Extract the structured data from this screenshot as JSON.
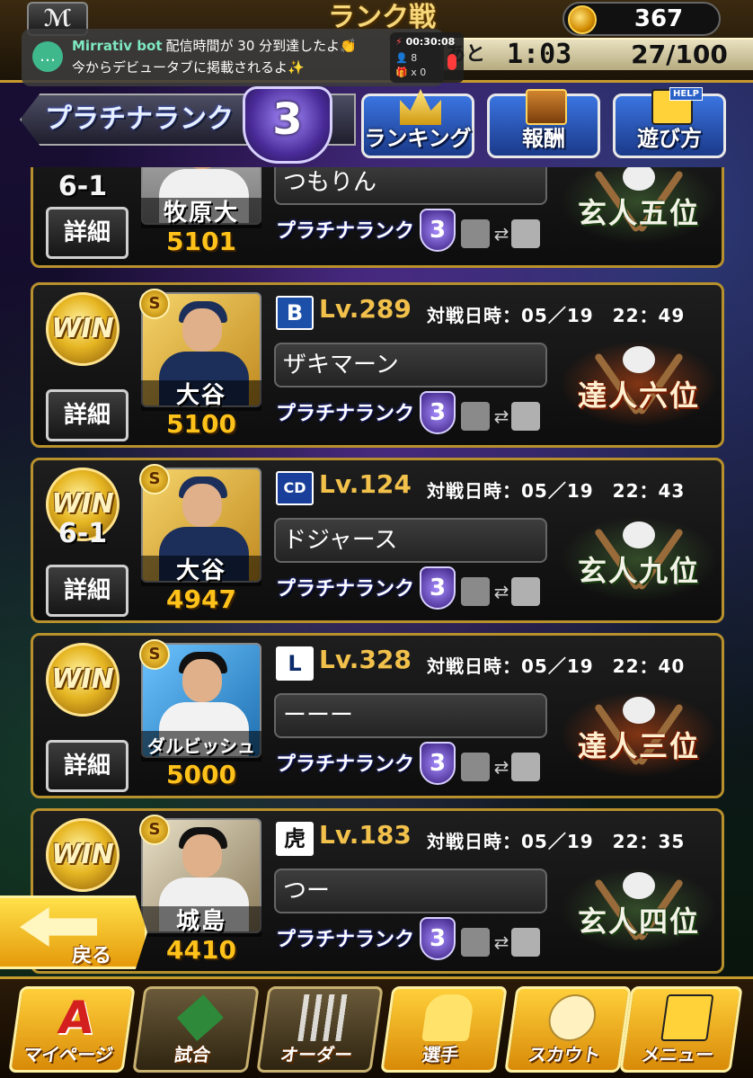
{
  "header": {
    "logo_text": "ℳ",
    "title": "ランク戦",
    "coins": "367",
    "time_label": "あと",
    "time_left": "1:03",
    "battle_count": "27/100"
  },
  "overlay": {
    "bot_name": "Mirrativ bot",
    "line1": "配信時間が 30 分到達したよ👏",
    "line2": "今からデビュータブに掲載されるよ✨",
    "elapsed": "00:30:08",
    "viewers": "8",
    "gifts": "x 0"
  },
  "rank": {
    "label": "プラチナランク",
    "level": "3"
  },
  "header_buttons": [
    {
      "label": "ランキング",
      "icon": "crown-icon"
    },
    {
      "label": "報酬",
      "icon": "treasure-chest-icon"
    },
    {
      "label": "遊び方",
      "icon": "help-icon",
      "tag": "HELP"
    }
  ],
  "matches": [
    {
      "result": "",
      "score": "6-1",
      "detail_label": "詳細",
      "player_name": "牧原大",
      "player_score": "5101",
      "grade": "",
      "team_logo": "",
      "level": "",
      "date": "",
      "opponent": "つもりん",
      "opp_rank": "プラチナランク",
      "opp_rank_num": "3",
      "title": "玄人五位",
      "title_style": "green",
      "photo_colors": [
        "#c9c9c9",
        "#f0f0f0",
        "#222"
      ]
    },
    {
      "result": "WIN",
      "score": "",
      "detail_label": "詳細",
      "player_name": "大谷",
      "player_score": "5100",
      "grade": "S",
      "team_logo": "B",
      "level": "Lv.289",
      "date": "対戦日時：05／19　22：49",
      "opponent": "ザキマーン",
      "opp_rank": "プラチナランク",
      "opp_rank_num": "3",
      "title": "達人六位",
      "title_style": "red",
      "photo_colors": [
        "#f5d46a",
        "#1c2f5a",
        "#1c2f5a"
      ]
    },
    {
      "result": "WIN",
      "score": "6-1",
      "detail_label": "詳細",
      "player_name": "大谷",
      "player_score": "4947",
      "grade": "S",
      "team_logo": "CD",
      "level": "Lv.124",
      "date": "対戦日時：05／19　22：43",
      "opponent": "ドジャース",
      "opp_rank": "プラチナランク",
      "opp_rank_num": "3",
      "title": "玄人九位",
      "title_style": "green",
      "photo_colors": [
        "#f5d46a",
        "#1c2f5a",
        "#1c2f5a"
      ]
    },
    {
      "result": "WIN",
      "score": "",
      "detail_label": "詳細",
      "player_name": "ダルビッシュ",
      "player_score": "5000",
      "grade": "S",
      "team_logo": "L",
      "level": "Lv.328",
      "date": "対戦日時：05／19　22：40",
      "opponent": "ーーー",
      "opp_rank": "プラチナランク",
      "opp_rank_num": "3",
      "title": "達人三位",
      "title_style": "red",
      "photo_colors": [
        "#3aa0e0",
        "#f2f2f2",
        "#111"
      ]
    },
    {
      "result": "WIN",
      "score": "",
      "detail_label": "詳細",
      "player_name": "城島",
      "player_score": "4410",
      "grade": "S",
      "team_logo": "虎",
      "level": "Lv.183",
      "date": "対戦日時：05／19　22：35",
      "opponent": "つー",
      "opp_rank": "プラチナランク",
      "opp_rank_num": "3",
      "title": "玄人四位",
      "title_style": "green",
      "photo_colors": [
        "#e8e0c8",
        "#f0f0f0",
        "#111"
      ]
    }
  ],
  "back_button": {
    "label": "戻る"
  },
  "nav": [
    {
      "label": "マイページ",
      "icon": "a-logo-icon"
    },
    {
      "label": "試合",
      "icon": "stadium-icon"
    },
    {
      "label": "オーダー",
      "icon": "lineup-icon"
    },
    {
      "label": "選手",
      "icon": "player-icon"
    },
    {
      "label": "スカウト",
      "icon": "scout-icon"
    },
    {
      "label": "メニュー",
      "icon": "menu-icon"
    }
  ]
}
